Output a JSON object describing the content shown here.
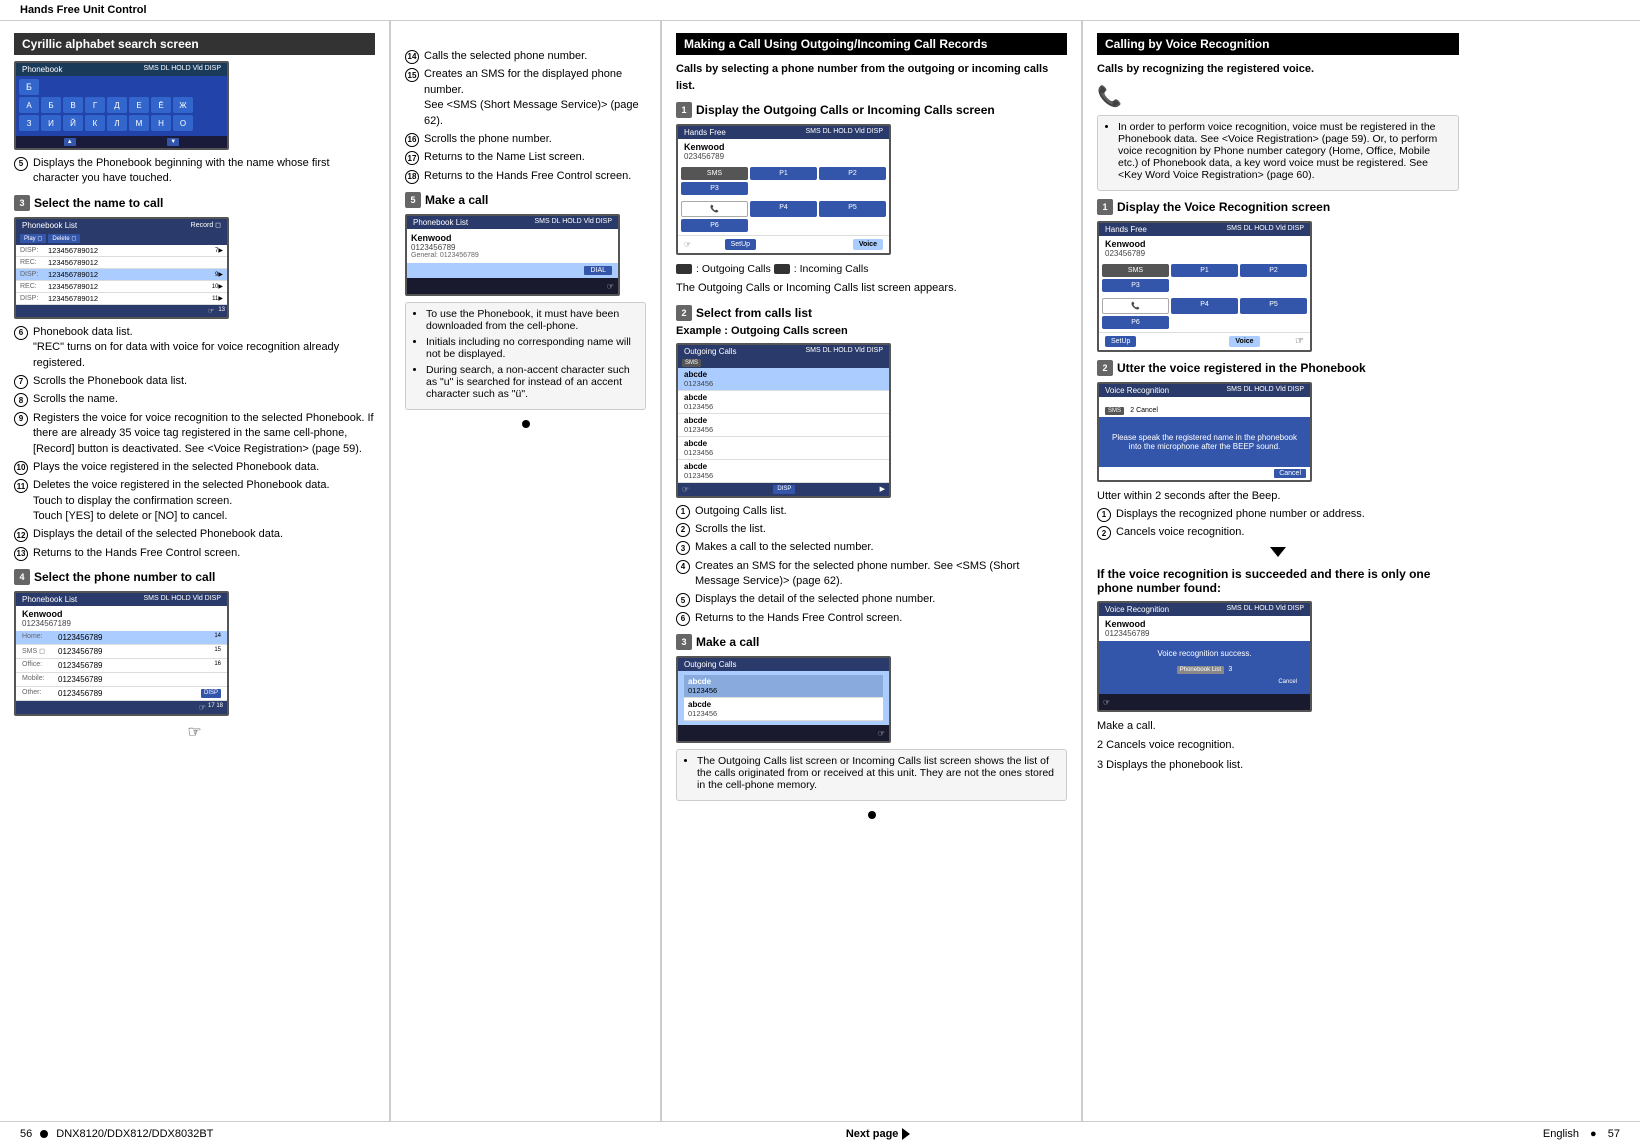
{
  "header": {
    "title": "Hands Free Unit Control"
  },
  "footer": {
    "left_page": "56",
    "model": "DNX8120/DDX812/DDX8032BT",
    "right_page": "57",
    "language": "English",
    "next_page_label": "Next page"
  },
  "col1": {
    "section_title": "Cyrillic alphabet search screen",
    "step5_label": "5",
    "step5_text": "Displays the Phonebook beginning with the name whose first character you have touched.",
    "step3_label": "3",
    "step3_title": "Select the name to call",
    "step3_num_items": [
      {
        "num": "6",
        "text": "Phonebook data list.\n\"REC\" turns on for data with voice for voice recognition already registered."
      },
      {
        "num": "7",
        "text": "Scrolls the Phonebook data list."
      },
      {
        "num": "8",
        "text": "Scrolls the name."
      },
      {
        "num": "9",
        "text": "Registers the voice for voice recognition to the selected Phonebook. If there are already 35 voice tag registered in the same cell-phone, [Record] button is deactivated. See <Voice Registration> (page 59)."
      },
      {
        "num": "10",
        "text": "Plays the voice registered in the selected Phonebook data."
      },
      {
        "num": "11",
        "text": "Deletes the voice registered in the selected Phonebook data.\nTouch to display the confirmation screen.\nTouch [YES] to delete or [NO] to cancel."
      },
      {
        "num": "12",
        "text": "Displays the detail of the selected Phonebook data."
      },
      {
        "num": "13",
        "text": "Returns to the Hands Free Control screen."
      }
    ],
    "step4_label": "4",
    "step4_title": "Select the phone number to call",
    "phonebook_cyrillic_letters": [
      "А",
      "Б",
      "В",
      "Г",
      "Д",
      "Е",
      "Ё",
      "Ж",
      "З",
      "И",
      "Й",
      "К",
      "Л",
      "М",
      "Н",
      "О"
    ],
    "phonebook_entries": [
      "123456789012",
      "123456789012",
      "123456789012",
      "123456789012",
      "123456789012"
    ],
    "phone_entries_detail": [
      {
        "type": "Home:",
        "num": "0123456789"
      },
      {
        "type": "Office:",
        "num": "0123456789"
      },
      {
        "type": "Mobile:",
        "num": "0123456789"
      },
      {
        "type": "Other:",
        "num": "0123456789"
      }
    ]
  },
  "col2": {
    "items_14_to_18": [
      {
        "num": "14",
        "text": "Calls the selected phone number."
      },
      {
        "num": "15",
        "text": "Creates an SMS for the displayed phone number.\nSee <SMS (Short Message Service)> (page 62)."
      },
      {
        "num": "16",
        "text": "Scrolls the phone number."
      },
      {
        "num": "17",
        "text": "Returns to the Name List screen."
      },
      {
        "num": "18",
        "text": "Returns to the Hands Free Control screen."
      }
    ],
    "step5_label": "5",
    "step5_title": "Make a call",
    "call_name": "Kenwood",
    "call_number": "0123456789",
    "call_type": "General:",
    "call_type_num": "0123456789",
    "note_items": [
      "To use the Phonebook, it must have been downloaded from the cell-phone.",
      "Initials including no corresponding name will not be displayed.",
      "During search, a non-accent character such as \"u\" is searched for instead of an accent character such as \"ü\"."
    ]
  },
  "col3": {
    "section_title": "Making a Call Using Outgoing/Incoming Call Records",
    "intro": "Calls by selecting a phone number from the outgoing or incoming calls list.",
    "step1_label": "1",
    "step1_title": "Display the Outgoing Calls or Incoming Calls screen",
    "hf_contact_name": "Kenwood",
    "hf_contact_num": "023456789",
    "hf_buttons": [
      "P1",
      "P2",
      "P3",
      "P4",
      "P5",
      "P6"
    ],
    "outgoing_icon_label": ": Outgoing Calls",
    "incoming_icon_label": ": Incoming Calls",
    "screen_desc": "The Outgoing Calls or Incoming Calls list screen appears.",
    "step2_label": "2",
    "step2_title": "Select from calls list",
    "example_label": "Example : Outgoing Calls screen",
    "outgoing_calls": [
      {
        "name": "abcde",
        "num": "0123456"
      },
      {
        "name": "abcde",
        "num": "0123456"
      },
      {
        "name": "abcde",
        "num": "0123456"
      },
      {
        "name": "abcde",
        "num": "0123456"
      },
      {
        "name": "abcde",
        "num": "0123456"
      }
    ],
    "step2_items": [
      {
        "num": "1",
        "text": "Outgoing Calls list."
      },
      {
        "num": "2",
        "text": "Scrolls the list."
      },
      {
        "num": "3",
        "text": "Makes a call to the selected number."
      },
      {
        "num": "4",
        "text": "Creates an SMS for the selected phone number. See <SMS (Short Message Service)> (page 62)."
      },
      {
        "num": "5",
        "text": "Displays the detail of the selected phone number."
      },
      {
        "num": "6",
        "text": "Returns to the Hands Free Control screen."
      }
    ],
    "step3_label": "3",
    "step3_title": "Make a call",
    "outgoing_make_call_entries": [
      {
        "name": "abcde",
        "num": "0123456"
      },
      {
        "name": "abcde",
        "num": "0123456"
      }
    ],
    "note_text": "The Outgoing Calls list screen or Incoming Calls list screen shows the list of the calls originated from or received at this unit. They are not the ones stored in the cell-phone memory."
  },
  "col4": {
    "section_title": "Calling by Voice Recognition",
    "intro": "Calls by recognizing the registered voice.",
    "note_text": "In order to perform voice recognition, voice must be registered in the Phonebook data. See <Voice Registration> (page 59). Or, to perform voice recognition by Phone number category (Home, Office, Mobile etc.) of Phonebook data, a key word voice must be registered. See <Key Word Voice Registration> (page 60).",
    "step1_label": "1",
    "step1_title": "Display the Voice Recognition screen",
    "vr_contact_name": "Kenwood",
    "vr_contact_num": "023456789",
    "vr_buttons": [
      "P1",
      "P2",
      "P3",
      "P4",
      "P5",
      "P6"
    ],
    "step2_label": "2",
    "step2_title": "Utter the voice registered in the Phonebook",
    "vr_prompt": "Please speak the registered name in the phonebook into the microphone after the BEEP sound.",
    "vr_cancel_label": "Cancel",
    "utter_note": "Utter within 2 seconds after the Beep.",
    "result_items": [
      {
        "num": "1",
        "text": "Displays the recognized phone number or address."
      },
      {
        "num": "2",
        "text": "Cancels voice recognition."
      }
    ],
    "if_succeeded_title": "If the voice recognition is succeeded and there is only one phone number found:",
    "vr_success_msg": "Voice recognition success.",
    "vr_success_contact": "Kenwood",
    "vr_success_num": "0123456789",
    "vr_cancel2": "Cancel",
    "vr_pb_list_label": "Phonebook List",
    "make_call_label": "Make a call.",
    "cancel_label": "2  Cancels voice recognition.",
    "display_label": "3  Displays the phonebook list."
  },
  "colors": {
    "header_bg": "#333333",
    "section_header_bg": "#333333",
    "making_call_header_bg": "#1a1a1a",
    "calling_header_bg": "#1a1a1a",
    "screen_bg": "#1a1a2e",
    "button_bg": "#3355aa",
    "highlight_bg": "#aaccff"
  }
}
